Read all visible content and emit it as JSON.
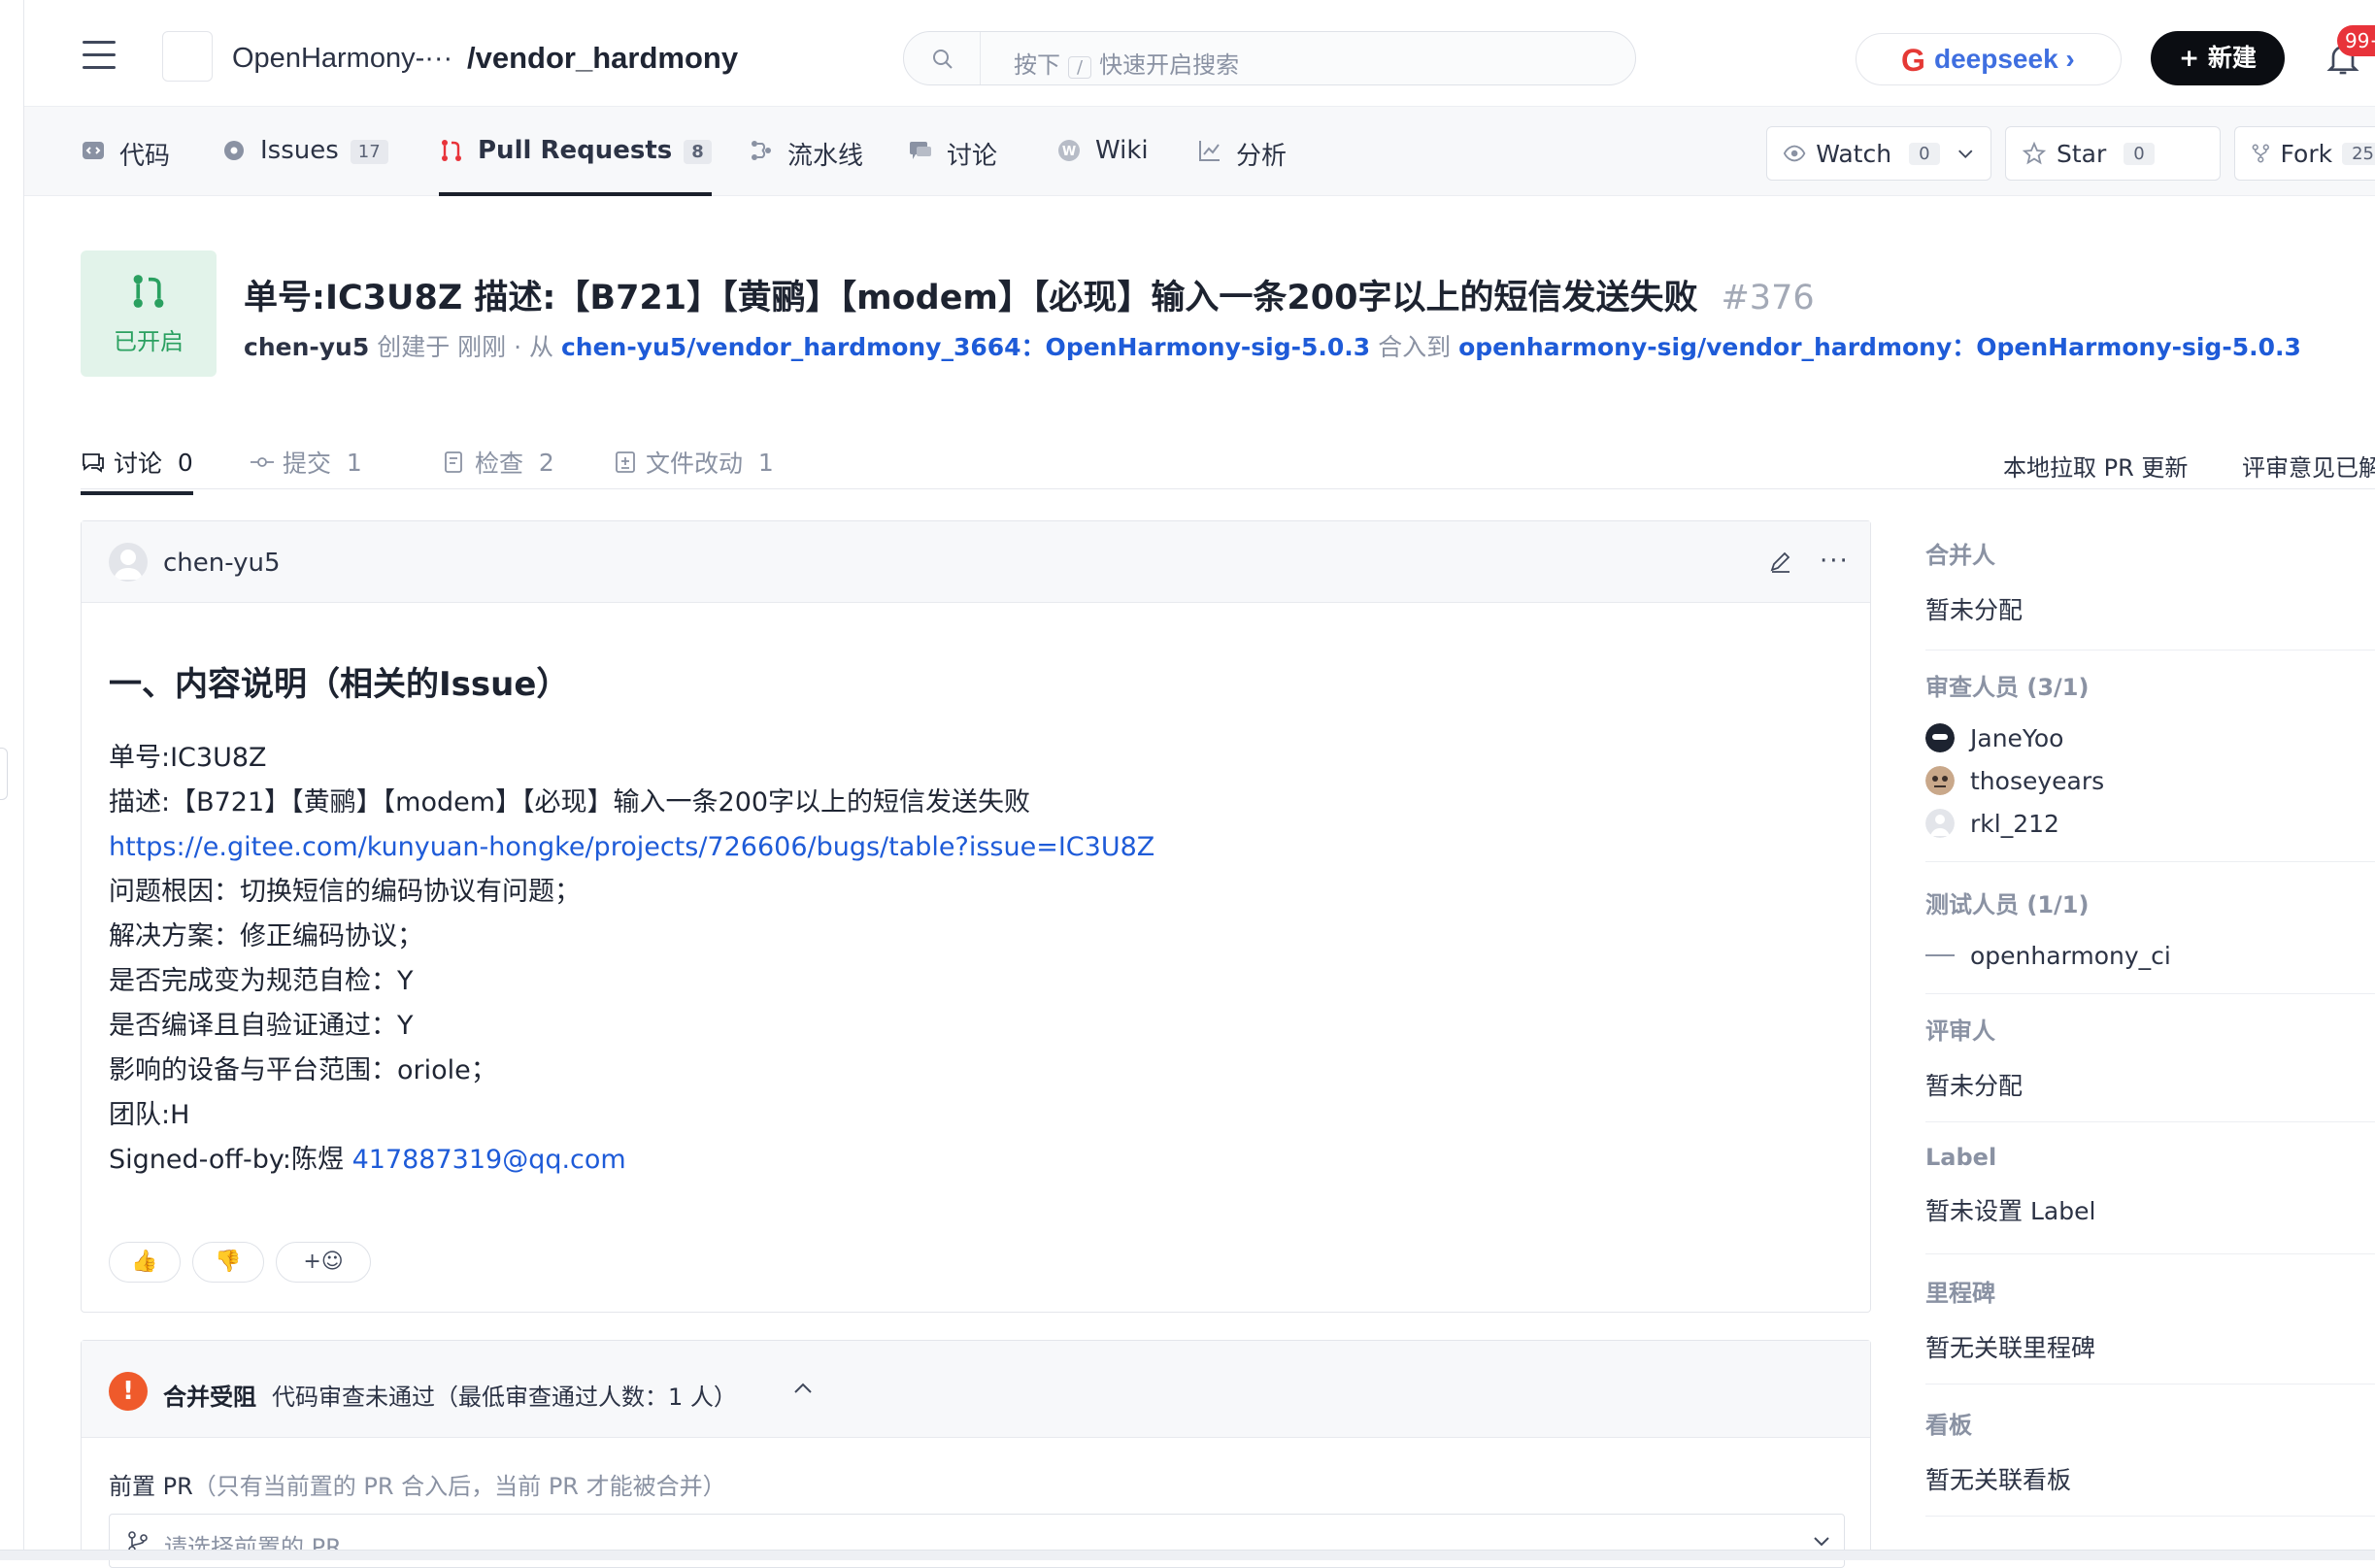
{
  "header": {
    "org": "OpenHarmony-···",
    "repo": "/vendor_hardmony",
    "search_placeholder_pre": "按下",
    "search_key": "/",
    "search_placeholder_post": "快速开启搜索",
    "deepseek_label": "deepseek ›",
    "new_button": "+ 新建",
    "notifications": "99+"
  },
  "repo_nav": {
    "items": [
      {
        "label": "代码",
        "icon": "code-icon"
      },
      {
        "label": "Issues",
        "count": "17",
        "icon": "issue-icon"
      },
      {
        "label": "Pull Requests",
        "count": "8",
        "icon": "pull-request-icon",
        "active": true
      },
      {
        "label": "流水线",
        "icon": "pipeline-icon"
      },
      {
        "label": "讨论",
        "icon": "discussion-icon"
      },
      {
        "label": "Wiki",
        "icon": "wiki-icon"
      },
      {
        "label": "分析",
        "icon": "chart-icon"
      }
    ],
    "watch": {
      "label": "Watch",
      "count": "0"
    },
    "star": {
      "label": "Star",
      "count": "0"
    },
    "fork": {
      "label": "Fork",
      "count": "25"
    }
  },
  "pr": {
    "status": "已开启",
    "title": "单号:IC3U8Z 描述:【B721】【黄鹂】【modem】【必现】输入一条200字以上的短信发送失败",
    "number": "#376",
    "author": "chen-yu5",
    "created": "创建于 刚刚 · 从",
    "source_branch": "chen-yu5/vendor_hardmony_3664：OpenHarmony-sig-5.0.3",
    "merge_into": "合入到",
    "target_branch": "openharmony-sig/vendor_hardmony：OpenHarmony-sig-5.0.3"
  },
  "tabs": {
    "discuss": {
      "label": "讨论",
      "count": "0"
    },
    "commits": {
      "label": "提交",
      "count": "1"
    },
    "checks": {
      "label": "检查",
      "count": "2"
    },
    "files": {
      "label": "文件改动",
      "count": "1"
    },
    "pull_local": "本地拉取 PR 更新",
    "resolved": "评审意见已解决"
  },
  "comment": {
    "user": "chen-yu5",
    "heading": "一、内容说明（相关的Issue）",
    "lines": [
      "单号:IC3U8Z",
      "描述:【B721】【黄鹂】【modem】【必现】输入一条200字以上的短信发送失败",
      "https://e.gitee.com/kunyuan-hongke/projects/726606/bugs/table?issue=IC3U8Z",
      "问题根因：切换短信的编码协议有问题；",
      "解决方案：修正编码协议；",
      "是否完成变为规范自检：Y",
      "是否编译且自验证通过：Y",
      "影响的设备与平台范围：oriole；",
      "团队:H"
    ],
    "signed_prefix": "Signed-off-by:陈煜 ",
    "signed_email": "417887319@qq.com",
    "react_up": "👍",
    "react_down": "👎",
    "react_add": "+☺"
  },
  "merge": {
    "title": "合并受阻",
    "desc": "代码审查未通过（最低审查通过人数：1 人）",
    "prev_label": "前置 PR",
    "prev_hint": "（只有当前置的 PR 合入后，当前 PR 才能被合并）",
    "prev_placeholder": "请选择前置的 PR"
  },
  "sidebar": {
    "merger": {
      "title": "合并人",
      "value": "暂未分配"
    },
    "reviewers": {
      "title": "审查人员 (3/1)",
      "people": [
        "JaneYoo",
        "thoseyears",
        "rkl_212"
      ]
    },
    "testers": {
      "title": "测试人员 (1/1)",
      "people": [
        "openharmony_ci"
      ]
    },
    "assessor": {
      "title": "评审人",
      "value": "暂未分配"
    },
    "label": {
      "title": "Label",
      "value": "暂未设置 Label"
    },
    "milestone": {
      "title": "里程碑",
      "value": "暂无关联里程碑"
    },
    "board": {
      "title": "看板",
      "value": "暂无关联看板"
    }
  },
  "colors": {
    "accent": "#1e5bd8",
    "open_green": "#2aa060",
    "warn": "#ef5a2b",
    "badge": "#e8333a"
  }
}
